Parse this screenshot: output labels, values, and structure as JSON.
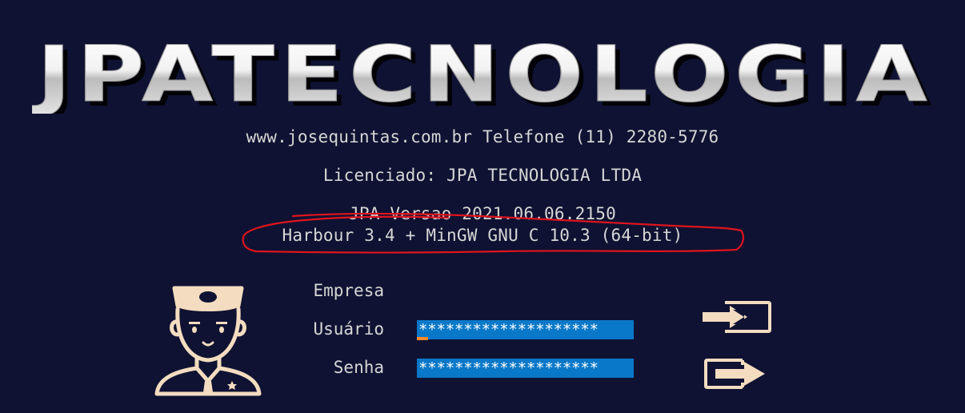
{
  "brand": {
    "logo_text": "JPATECNOLOGIA"
  },
  "info": {
    "website_phone": "www.josequintas.com.br Telefone (11) 2280-5776",
    "licensee": "Licenciado: JPA TECNOLOGIA LTDA",
    "version": "JPA Versao 2021.06.06.2150",
    "compiler": "Harbour 3.4 + MinGW GNU C 10.3 (64-bit)"
  },
  "login": {
    "empresa_label": "Empresa",
    "usuario_label": "Usuário",
    "senha_label": "Senha",
    "usuario_value": "********************",
    "senha_value": "********************"
  },
  "icons": {
    "avatar": "police-officer-avatar-icon",
    "enter": "login-enter-icon",
    "exit": "logout-exit-icon"
  },
  "colors": {
    "background": "#0f1232",
    "field": "#0a78c8",
    "cursor": "#ff8a2b",
    "icon": "#f3dcc0",
    "annotation": "#e0141e"
  }
}
